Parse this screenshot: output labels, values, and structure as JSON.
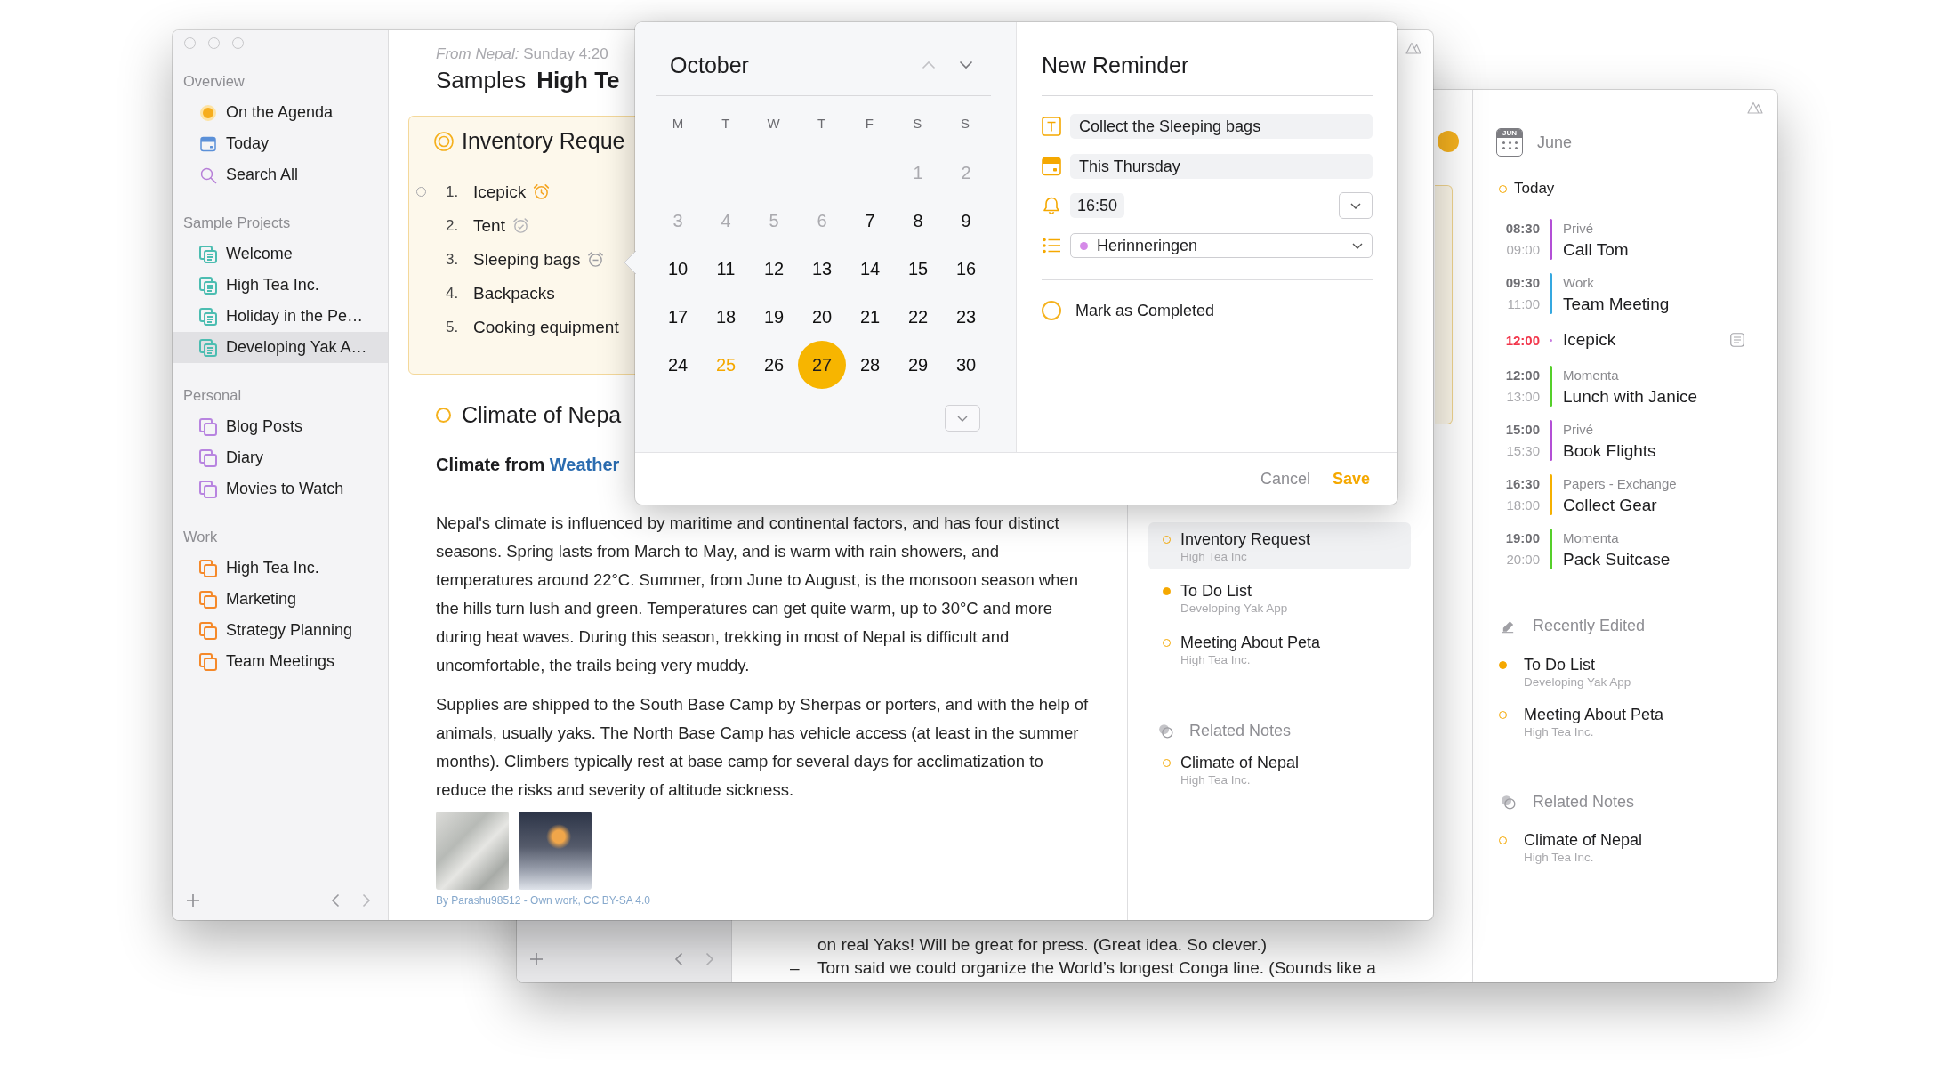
{
  "back_window": {
    "note_lines": [
      {
        "text": "on real Yaks! Will be great for press. (Great idea. So clever.)"
      },
      {
        "marker": "–",
        "text": "Tom said we could organize the World’s longest Conga line. (Sounds like a"
      }
    ],
    "agenda": {
      "month_badge": "JUN",
      "month": "June",
      "day": "Today",
      "entries": [
        {
          "kind": "event",
          "start": "08:30",
          "end": "09:00",
          "calendar": "Privé",
          "title": "Call Tom",
          "color": "#b34fd6"
        },
        {
          "kind": "event",
          "start": "09:30",
          "end": "11:00",
          "calendar": "Work",
          "title": "Team Meeting",
          "color": "#35a8e0"
        },
        {
          "kind": "reminder",
          "start": "12:00",
          "title": "Icepick",
          "color": "#c77be0"
        },
        {
          "kind": "event",
          "start": "12:00",
          "end": "13:00",
          "calendar": "Momenta",
          "title": "Lunch with Janice",
          "color": "#55cf2a"
        },
        {
          "kind": "event",
          "start": "15:00",
          "end": "15:30",
          "calendar": "Privé",
          "title": "Book Flights",
          "color": "#b34fd6"
        },
        {
          "kind": "event",
          "start": "16:30",
          "end": "18:00",
          "calendar": "Papers - Exchange",
          "title": "Collect Gear",
          "color": "#f5b000"
        },
        {
          "kind": "event",
          "start": "19:00",
          "end": "20:00",
          "calendar": "Momenta",
          "title": "Pack Suitcase",
          "color": "#55cf2a"
        }
      ]
    },
    "recently_edited": {
      "title": "Recently Edited",
      "items": [
        {
          "title": "To Do List",
          "project": "Developing Yak App",
          "filled": true
        },
        {
          "title": "Meeting About Peta",
          "project": "High Tea Inc.",
          "filled": false
        }
      ]
    },
    "related_notes": {
      "title": "Related Notes",
      "items": [
        {
          "title": "Climate of Nepal",
          "project": "High Tea Inc.",
          "filled": false
        }
      ]
    }
  },
  "front_window": {
    "sidebar": [
      {
        "title": "Overview",
        "items": [
          {
            "kind": "agenda",
            "label": "On the Agenda",
            "selected": false
          },
          {
            "kind": "today",
            "label": "Today",
            "selected": false
          },
          {
            "kind": "search",
            "label": "Search All",
            "selected": false
          }
        ]
      },
      {
        "title": "Sample Projects",
        "color": "#4cbdb1",
        "items": [
          {
            "kind": "notebook",
            "label": "Welcome",
            "selected": false
          },
          {
            "kind": "notebook",
            "label": "High Tea Inc.",
            "selected": false
          },
          {
            "kind": "notebook",
            "label": "Holiday in the Pe…",
            "selected": false
          },
          {
            "kind": "notebook",
            "label": "Developing Yak A…",
            "selected": true
          }
        ]
      },
      {
        "title": "Personal",
        "color": "#b884e0",
        "items": [
          {
            "kind": "folder",
            "label": "Blog Posts",
            "selected": false
          },
          {
            "kind": "folder",
            "label": "Diary",
            "selected": false
          },
          {
            "kind": "folder",
            "label": "Movies to Watch",
            "selected": false
          }
        ]
      },
      {
        "title": "Work",
        "color": "#f5892a",
        "items": [
          {
            "kind": "folder",
            "label": "High Tea Inc.",
            "selected": false
          },
          {
            "kind": "folder",
            "label": "Marketing",
            "selected": false
          },
          {
            "kind": "folder",
            "label": "Strategy Planning",
            "selected": false
          },
          {
            "kind": "folder",
            "label": "Team Meetings",
            "selected": false
          }
        ]
      }
    ],
    "note": {
      "byline": "*From Nepal:* Sunday 4:20",
      "breadcrumb": "Samples",
      "title": "High Te",
      "checklist": {
        "title": "Inventory Reque",
        "items": [
          {
            "kind": "alarm",
            "number": "1.",
            "text": "Icepick",
            "hovered": true
          },
          {
            "kind": "alarm_done",
            "number": "2.",
            "text": "Tent",
            "hovered": false
          },
          {
            "kind": "alarm_snoozed",
            "number": "3.",
            "text": "Sleeping bags",
            "hovered": false
          },
          {
            "kind": "plain",
            "number": "4.",
            "text": "Backpacks",
            "hovered": false
          },
          {
            "kind": "plain",
            "number": "5.",
            "text": "Cooking equipment",
            "hovered": false
          }
        ]
      },
      "section": {
        "title": "Climate of Nepa",
        "heading": "Climate from",
        "heading_link": "Weather",
        "paragraphs": [
          "Nepal's climate is influenced by maritime and continental factors, and has four distinct seasons. Spring lasts from March to May, and is warm with rain showers, and temperatures around 22°C. Summer, from June to August, is the monsoon season when the hills turn lush and green. Temperatures can get quite warm, up to 30°C and more during heat waves. During this season, trekking in most of Nepal is difficult and uncomfortable, the trails being very muddy.",
          "Supplies are shipped to the South Base Camp by Sherpas or porters, and with the help of animals, usually yaks. The North Base Camp has vehicle access (at least in the summer months). Climbers typically rest at base camp for several days for acclimatization to reduce the risks and severity of altitude sickness."
        ],
        "caption": "By Parashu98512 - Own work, CC BY-SA 4.0"
      }
    },
    "side_panel": {
      "recent_items": [
        {
          "title": "Inventory Request",
          "project": "High Tea Inc",
          "filled": false,
          "selected": true
        },
        {
          "title": "To Do List",
          "project": "Developing Yak App",
          "filled": true,
          "selected": false
        },
        {
          "title": "Meeting About Peta",
          "project": "High Tea Inc.",
          "filled": false,
          "selected": false
        }
      ],
      "related_notes": {
        "title": "Related Notes",
        "items": [
          {
            "title": "Climate of Nepal",
            "project": "High Tea Inc.",
            "filled": false,
            "selected": false
          }
        ]
      }
    }
  },
  "reminder_popover": {
    "calendar": {
      "month": "October",
      "weekdays": [
        "M",
        "T",
        "W",
        "T",
        "F",
        "S",
        "S"
      ],
      "weeks": [
        [
          {
            "day": "1",
            "muted": true,
            "today": false,
            "selected": false
          },
          {
            "day": "2",
            "muted": true,
            "today": false,
            "selected": false
          }
        ],
        [
          {
            "day": "3",
            "muted": true,
            "today": false,
            "selected": false
          },
          {
            "day": "4",
            "muted": true,
            "today": false,
            "selected": false
          },
          {
            "day": "5",
            "muted": true,
            "today": false,
            "selected": false
          },
          {
            "day": "6",
            "muted": true,
            "today": false,
            "selected": false
          },
          {
            "day": "7",
            "muted": false,
            "today": false,
            "selected": false
          },
          {
            "day": "8",
            "muted": false,
            "today": false,
            "selected": false
          },
          {
            "day": "9",
            "muted": false,
            "today": false,
            "selected": false
          }
        ],
        [
          {
            "day": "10",
            "muted": false,
            "today": false,
            "selected": false
          },
          {
            "day": "11",
            "muted": false,
            "today": false,
            "selected": false
          },
          {
            "day": "12",
            "muted": false,
            "today": false,
            "selected": false
          },
          {
            "day": "13",
            "muted": false,
            "today": false,
            "selected": false
          },
          {
            "day": "14",
            "muted": false,
            "today": false,
            "selected": false
          },
          {
            "day": "15",
            "muted": false,
            "today": false,
            "selected": false
          },
          {
            "day": "16",
            "muted": false,
            "today": false,
            "selected": false
          }
        ],
        [
          {
            "day": "17",
            "muted": false,
            "today": false,
            "selected": false
          },
          {
            "day": "18",
            "muted": false,
            "today": false,
            "selected": false
          },
          {
            "day": "19",
            "muted": false,
            "today": false,
            "selected": false
          },
          {
            "day": "20",
            "muted": false,
            "today": false,
            "selected": false
          },
          {
            "day": "21",
            "muted": false,
            "today": false,
            "selected": false
          },
          {
            "day": "22",
            "muted": false,
            "today": false,
            "selected": false
          },
          {
            "day": "23",
            "muted": false,
            "today": false,
            "selected": false
          }
        ],
        [
          {
            "day": "24",
            "muted": false,
            "today": false,
            "selected": false
          },
          {
            "day": "25",
            "muted": false,
            "today": true,
            "selected": false
          },
          {
            "day": "26",
            "muted": false,
            "today": false,
            "selected": false
          },
          {
            "day": "27",
            "muted": false,
            "today": false,
            "selected": true
          },
          {
            "day": "28",
            "muted": false,
            "today": false,
            "selected": false
          },
          {
            "day": "29",
            "muted": false,
            "today": false,
            "selected": false
          },
          {
            "day": "30",
            "muted": false,
            "today": false,
            "selected": false
          }
        ]
      ]
    },
    "form": {
      "title": "New Reminder",
      "name": "Collect the Sleeping bags",
      "date": "This Thursday",
      "time": "16:50",
      "list": {
        "label": "Herinneringen",
        "color": "#d58ae8"
      },
      "completed": {
        "label": "Mark as Completed",
        "checked": false
      }
    },
    "buttons": [
      {
        "kind": "cancel",
        "label": "Cancel"
      },
      {
        "kind": "save",
        "label": "Save"
      }
    ]
  }
}
